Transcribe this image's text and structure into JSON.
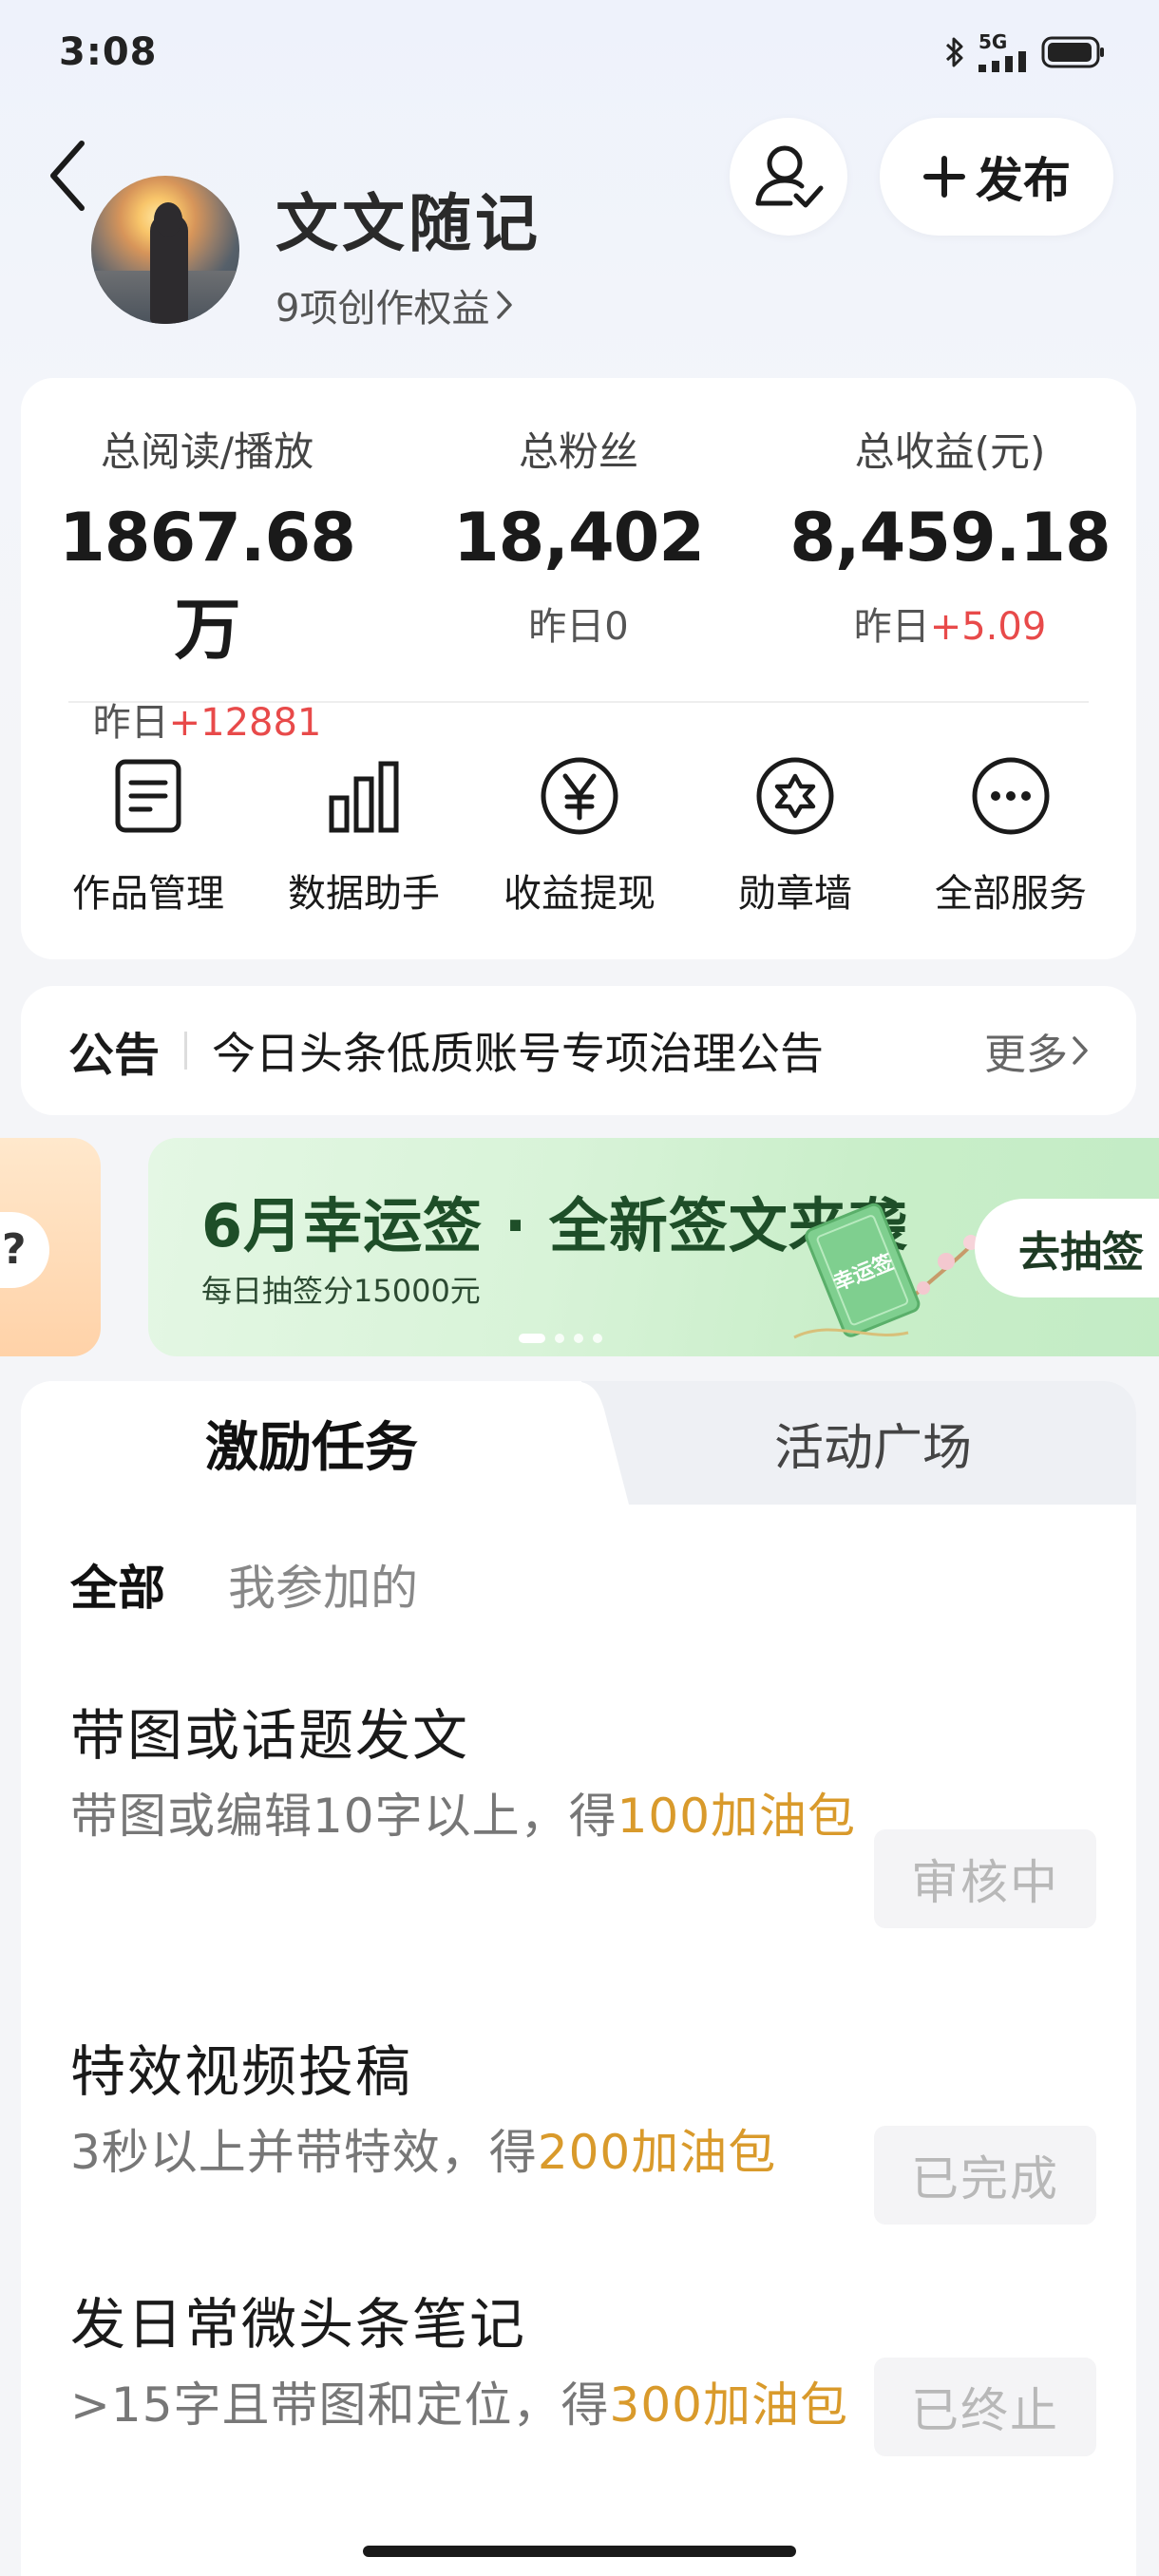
{
  "status_bar": {
    "time": "3:08",
    "network": "5G",
    "icons": [
      "bluetooth-icon",
      "signal-icon",
      "battery-icon"
    ]
  },
  "header": {
    "user_name": "文文随记",
    "rights_link": "9项创作权益",
    "publish_label": "发布",
    "icons": [
      "back-arrow-icon",
      "user-check-icon",
      "plus-icon",
      "chevron-right-icon"
    ]
  },
  "stats": {
    "reads": {
      "label": "总阅读/播放",
      "value": "1867.68万",
      "sub_prefix": "昨日",
      "sub_value": "+12881"
    },
    "fans": {
      "label": "总粉丝",
      "value": "18,402",
      "sub_prefix": "昨日",
      "sub_value": "0"
    },
    "income": {
      "label": "总收益(元)",
      "value": "8,459.18",
      "sub_prefix": "昨日",
      "sub_value": "+5.09"
    }
  },
  "services": [
    {
      "label": "作品管理",
      "icon": "document-icon"
    },
    {
      "label": "数据助手",
      "icon": "bar-chart-icon"
    },
    {
      "label": "收益提现",
      "icon": "yuan-icon"
    },
    {
      "label": "勋章墙",
      "icon": "badge-icon"
    },
    {
      "label": "全部服务",
      "icon": "more-icon"
    }
  ],
  "notice": {
    "title": "公告",
    "text": "今日头条低质账号专项治理公告",
    "more": "更多"
  },
  "banner": {
    "left_partial_text": "?",
    "title": "6月幸运签 · 全新签文来袭",
    "subtitle": "每日抽签分15000元",
    "button": "去抽签",
    "deco_text": "幸运签",
    "active_slide": 1,
    "slide_count": 4
  },
  "tasks": {
    "tabs": [
      "激励任务",
      "活动广场"
    ],
    "active_tab": 0,
    "filters": [
      "全部",
      "我参加的"
    ],
    "active_filter": 0,
    "items": [
      {
        "title": "带图或话题发文",
        "desc_prefix": "带图或编辑10字以上，得",
        "reward": "100加油包",
        "status": "审核中"
      },
      {
        "title": "特效视频投稿",
        "desc_prefix": "3秒以上并带特效，得",
        "reward": "200加油包",
        "status": "已完成"
      },
      {
        "title": "发日常微头条笔记",
        "desc_prefix": ">15字且带图和定位，得",
        "reward": "300加油包",
        "status": "已终止"
      }
    ]
  },
  "colors": {
    "accent_red": "#e84a4a",
    "reward_orange": "#d99a2b",
    "banner_green": "#1e4e28"
  }
}
